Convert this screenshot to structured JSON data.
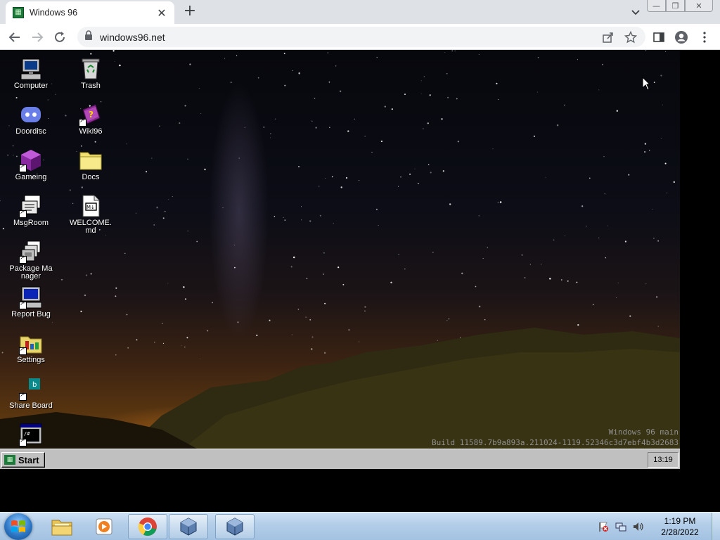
{
  "browser": {
    "tab_title": "Windows 96",
    "address": "windows96.net",
    "new_tab_symbol": "+",
    "close_symbol": "✕"
  },
  "desktop": {
    "icons": [
      {
        "label": "Computer",
        "icon": "computer-icon"
      },
      {
        "label": "Trash",
        "icon": "trash-icon"
      },
      {
        "label": "Doordisc",
        "icon": "doordisc-icon"
      },
      {
        "label": "Wiki96",
        "icon": "wiki96-icon"
      },
      {
        "label": "Gameing",
        "icon": "gameing-icon"
      },
      {
        "label": "Docs",
        "icon": "docs-folder-icon"
      },
      {
        "label": "MsgRoom",
        "icon": "msgroom-icon"
      },
      {
        "label": "WELCOME.md",
        "icon": "markdown-file-icon"
      },
      {
        "label": "Package Manager",
        "icon": "package-manager-icon"
      },
      {
        "label": "Report Bug",
        "icon": "report-bug-icon"
      },
      {
        "label": "Settings",
        "icon": "settings-icon"
      },
      {
        "label": "Share Board",
        "icon": "share-board-icon"
      },
      {
        "label": "",
        "icon": "terminal-icon"
      }
    ],
    "watermark_line1": "Windows 96 main",
    "watermark_line2": "Build 11589.7b9a893a.211024-1119.52346c3d7ebf4b3d2683"
  },
  "win96_taskbar": {
    "start_label": "Start",
    "clock": "13:19"
  },
  "win7_taskbar": {
    "apps": [
      "windows-explorer-icon",
      "media-player-icon",
      "chrome-icon",
      "virtualbox-icon",
      "virtualbox-icon"
    ],
    "time": "1:19 PM",
    "date": "2/28/2022"
  },
  "colors": {
    "win96_green": "#1e7a3a",
    "win96_gray": "#c0c0c0",
    "chrome_tabstrip": "#dee1e6"
  }
}
